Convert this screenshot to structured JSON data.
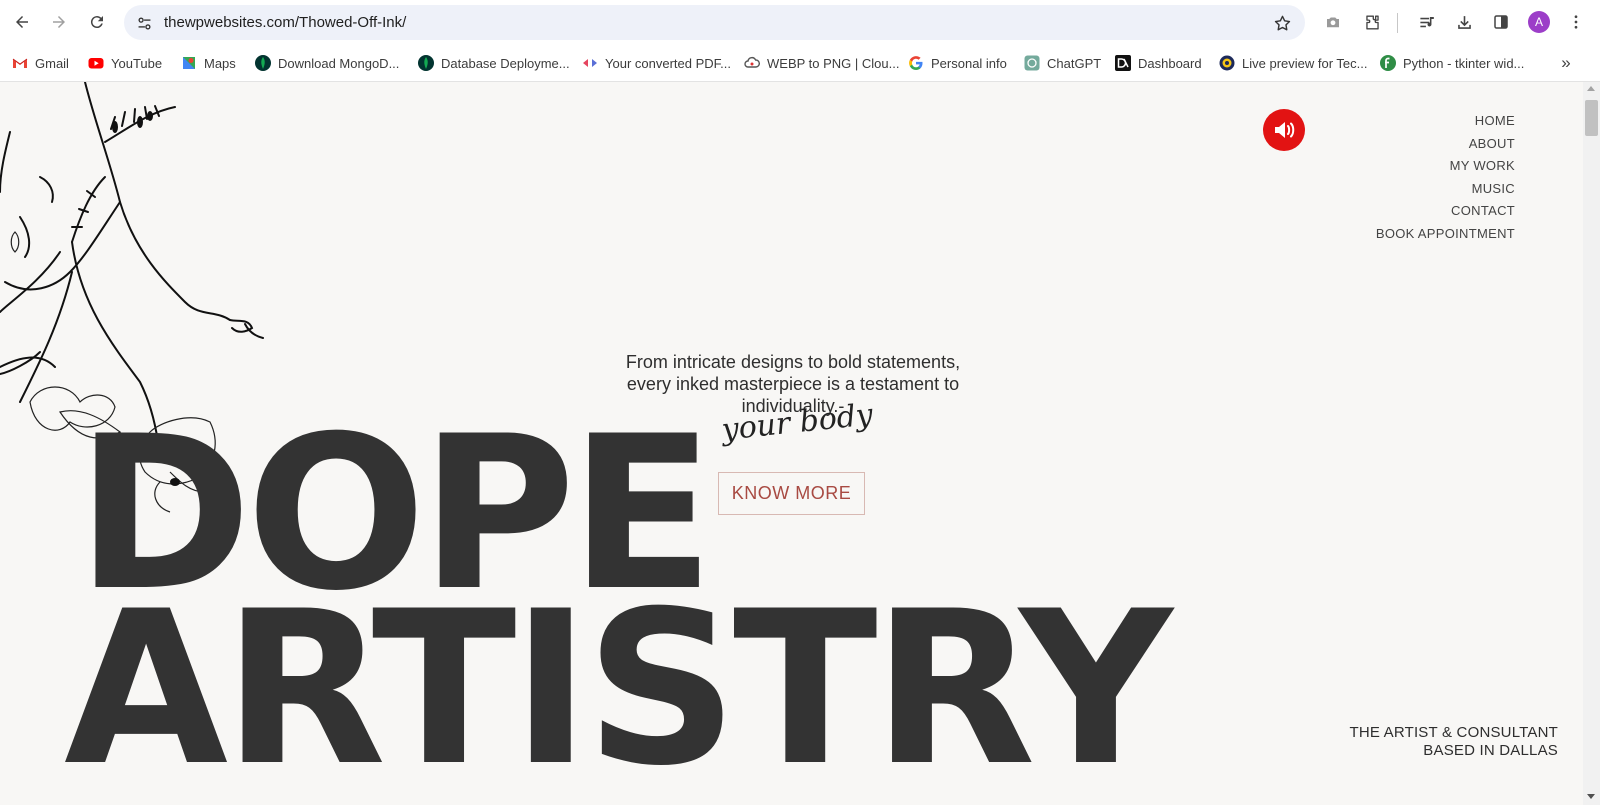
{
  "browser": {
    "url": "thewpwebsites.com/Thowed-Off-Ink/",
    "avatar_letter": "A",
    "toolbar_icons": [
      "back-icon",
      "forward-icon",
      "reload-icon",
      "site-info-icon",
      "bookmark-star-icon",
      "screenshot-icon",
      "extensions-icon",
      "media-control-icon",
      "downloads-icon",
      "side-panel-icon",
      "menu-kebab-icon"
    ]
  },
  "bookmarks": [
    {
      "label": "Gmail",
      "icon": "gmail-icon"
    },
    {
      "label": "YouTube",
      "icon": "youtube-icon"
    },
    {
      "label": "Maps",
      "icon": "maps-icon"
    },
    {
      "label": "Download MongoD...",
      "icon": "mongodb-icon"
    },
    {
      "label": "Database Deployme...",
      "icon": "mongodb-icon"
    },
    {
      "label": "Your converted PDF...",
      "icon": "pdf-converter-icon"
    },
    {
      "label": "WEBP to PNG | Clou...",
      "icon": "cloud-icon"
    },
    {
      "label": "Personal info",
      "icon": "google-icon"
    },
    {
      "label": "ChatGPT",
      "icon": "chatgpt-icon"
    },
    {
      "label": "Dashboard",
      "icon": "dashboard-icon"
    },
    {
      "label": "Live preview for Tec...",
      "icon": "live-preview-icon"
    },
    {
      "label": "Python - tkinter wid...",
      "icon": "python-icon"
    }
  ],
  "bookmarks_overflow": "»",
  "site": {
    "nav": [
      "HOME",
      "ABOUT",
      "MY WORK",
      "MUSIC",
      "CONTACT",
      "BOOK APPOINTMENT"
    ],
    "tagline_line1": "From intricate designs to bold statements,",
    "tagline_line2": "every inked masterpiece is a testament to individuality.-",
    "signature": "your body",
    "cta": "KNOW MORE",
    "headline_1": "DOPE",
    "headline_2": "ARTISTRY",
    "based_line1": "THE ARTIST & CONSULTANT",
    "based_line2": "BASED IN DALLAS",
    "sound_icon": "speaker-icon",
    "colors": {
      "background": "#f8f7f5",
      "headline": "#333333",
      "accent_red": "#e21313",
      "cta_text": "#a84a42"
    }
  }
}
